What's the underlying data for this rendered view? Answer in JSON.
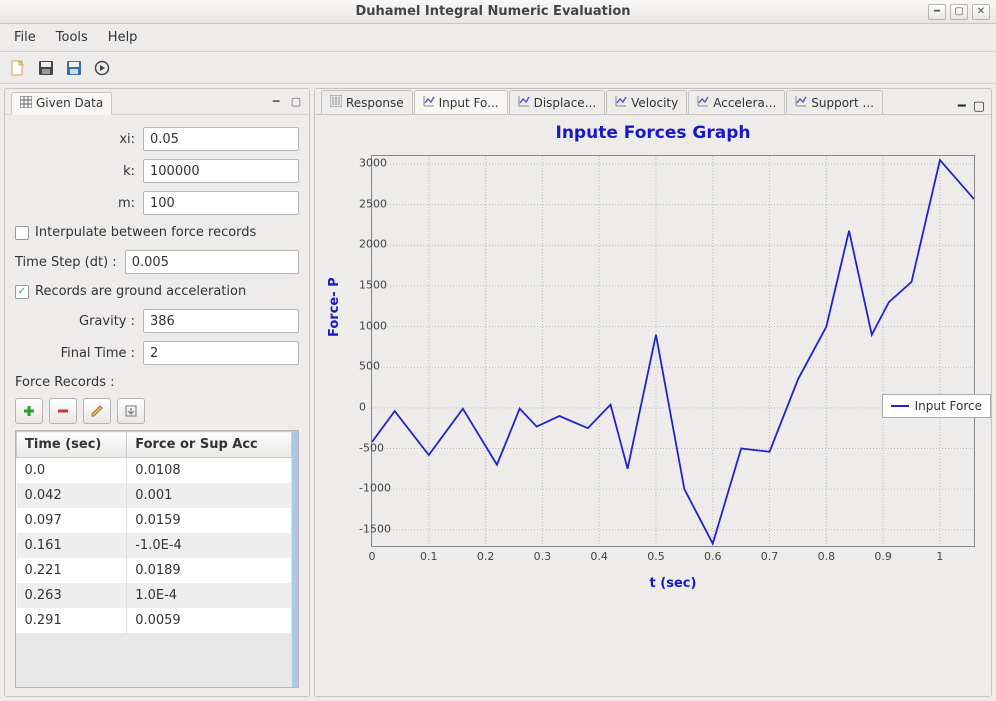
{
  "window": {
    "title": "Duhamel Integral Numeric Evaluation"
  },
  "menubar": {
    "file": "File",
    "tools": "Tools",
    "help": "Help"
  },
  "toolbar_icons": {
    "new": "new-file-icon",
    "save": "save-icon",
    "saveas": "save-as-icon",
    "run": "run-icon"
  },
  "left": {
    "title": "Given Data",
    "fields": {
      "xi_label": "xi:",
      "xi": "0.05",
      "k_label": "k:",
      "k": "100000",
      "m_label": "m:",
      "m": "100",
      "interpolate_label": "Interpulate between force records",
      "interpolate_checked": false,
      "dt_label": "Time Step (dt) :",
      "dt": "0.005",
      "ground_accel_label": "Records are ground acceleration",
      "ground_accel_checked": true,
      "gravity_label": "Gravity :",
      "gravity": "386",
      "final_time_label": "Final Time :",
      "final_time": "2",
      "force_records_label": "Force Records :"
    },
    "table": {
      "headers": [
        "Time (sec)",
        "Force or Sup Acc"
      ],
      "rows": [
        [
          "0.0",
          "0.0108"
        ],
        [
          "0.042",
          "0.001"
        ],
        [
          "0.097",
          "0.0159"
        ],
        [
          "0.161",
          "-1.0E-4"
        ],
        [
          "0.221",
          "0.0189"
        ],
        [
          "0.263",
          "1.0E-4"
        ],
        [
          "0.291",
          "0.0059"
        ]
      ]
    }
  },
  "right": {
    "tabs": [
      "Response",
      "Input Fo...",
      "Displace...",
      "Velocity",
      "Accelera...",
      "Support ..."
    ],
    "active_tab": 1,
    "legend": "Input Force"
  },
  "chart_data": {
    "type": "line",
    "title": "Inpute Forces Graph",
    "xlabel": "t (sec)",
    "ylabel": "Force- P",
    "ylim": [
      -1700,
      3100
    ],
    "xlim": [
      0,
      1.06
    ],
    "x_ticks": [
      0,
      0.1,
      0.2,
      0.3,
      0.4,
      0.5,
      0.6,
      0.7,
      0.8,
      0.9,
      1
    ],
    "y_ticks": [
      -1500,
      -1000,
      -500,
      0,
      500,
      1000,
      1500,
      2000,
      2500,
      3000
    ],
    "series": [
      {
        "name": "Input Force",
        "x": [
          0.0,
          0.04,
          0.1,
          0.16,
          0.22,
          0.26,
          0.29,
          0.33,
          0.38,
          0.42,
          0.45,
          0.5,
          0.55,
          0.6,
          0.65,
          0.7,
          0.75,
          0.8,
          0.84,
          0.88,
          0.91,
          0.95,
          1.0,
          1.06
        ],
        "y": [
          -420,
          -40,
          -580,
          -10,
          -700,
          -10,
          -230,
          -100,
          -250,
          40,
          -750,
          900,
          -1000,
          -1670,
          -500,
          -540,
          350,
          1000,
          2180,
          900,
          1300,
          1550,
          3050,
          2570
        ]
      }
    ]
  }
}
